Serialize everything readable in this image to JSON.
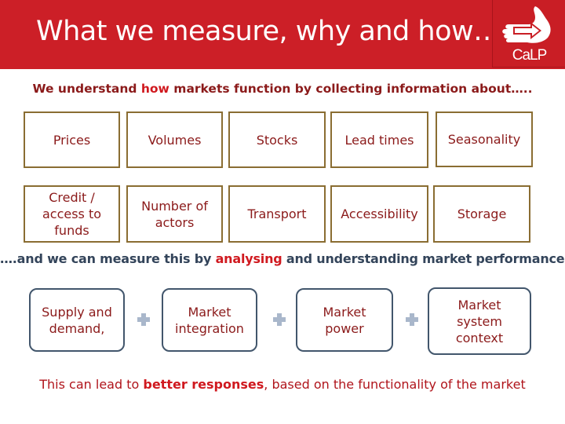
{
  "header": {
    "title": "What we measure, why and how…",
    "logo_text": "CaLP",
    "logo_icon": "hand-arrow-icon"
  },
  "intro": {
    "before": "We understand ",
    "highlight": "how",
    "after": " markets function by collecting information about….."
  },
  "factors": {
    "row1": [
      "Prices",
      "Volumes",
      "Stocks",
      "Lead times",
      "Seasonality"
    ],
    "row2": [
      "Credit / access to funds",
      "Number of actors",
      "Transport",
      "Accessibility",
      "Storage"
    ]
  },
  "middle": {
    "before": "….and we can measure this by ",
    "highlight": "analysing",
    "after": " and understanding market performance:"
  },
  "performance": {
    "items": [
      "Supply and demand,",
      "Market integration",
      "Market power",
      "Market system context"
    ],
    "connector": "plus-icon"
  },
  "footer": {
    "before": "This can lead to ",
    "bold": "better responses",
    "after": ", based on the functionality of the market"
  },
  "colors": {
    "header_red": "#cc1f27",
    "text_dark_red": "#8b1a1a",
    "highlight_red": "#d0191f",
    "factor_border": "#8a6d32",
    "perf_border": "#42566c",
    "plus_color": "#a9b7cb",
    "mid_text": "#33445a"
  }
}
